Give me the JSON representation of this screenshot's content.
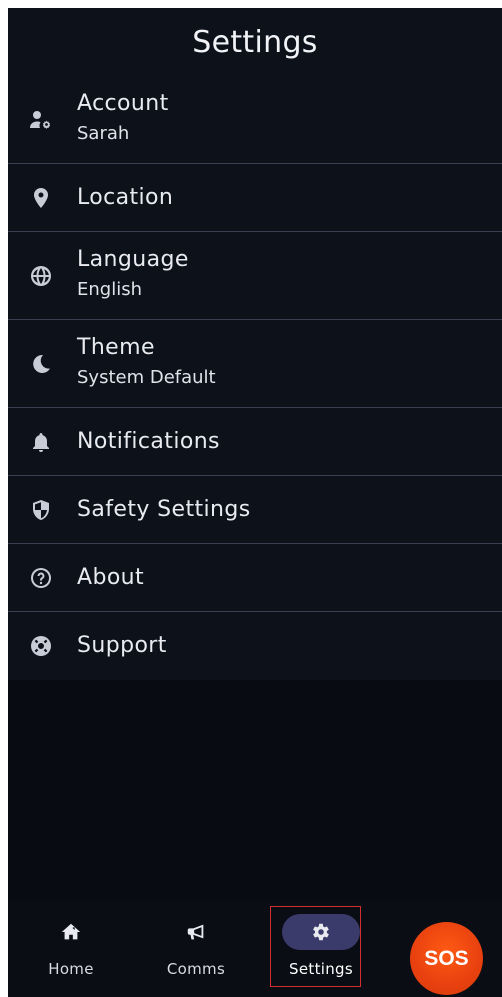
{
  "header": {
    "title": "Settings"
  },
  "settings": {
    "items": [
      {
        "label": "Account",
        "sub": "Sarah",
        "icon": "account-settings-icon"
      },
      {
        "label": "Location",
        "icon": "location-pin-icon"
      },
      {
        "label": "Language",
        "sub": "English",
        "icon": "globe-icon"
      },
      {
        "label": "Theme",
        "sub": "System Default",
        "icon": "moon-icon"
      },
      {
        "label": "Notifications",
        "icon": "bell-icon"
      },
      {
        "label": "Safety Settings",
        "icon": "shield-icon"
      },
      {
        "label": "About",
        "icon": "question-circle-icon"
      },
      {
        "label": "Support",
        "icon": "lifebuoy-icon"
      }
    ]
  },
  "nav": {
    "home": {
      "label": "Home",
      "icon": "home-icon"
    },
    "comms": {
      "label": "Comms",
      "icon": "megaphone-icon"
    },
    "settings": {
      "label": "Settings",
      "icon": "gear-icon",
      "active": true
    },
    "sos": {
      "label": "SOS"
    }
  },
  "colors": {
    "background": "#0a0d14",
    "accent_pill": "#3a3b6b",
    "sos": "#e8410f",
    "divider": "#3a4152",
    "highlight": "#d32f2f"
  }
}
